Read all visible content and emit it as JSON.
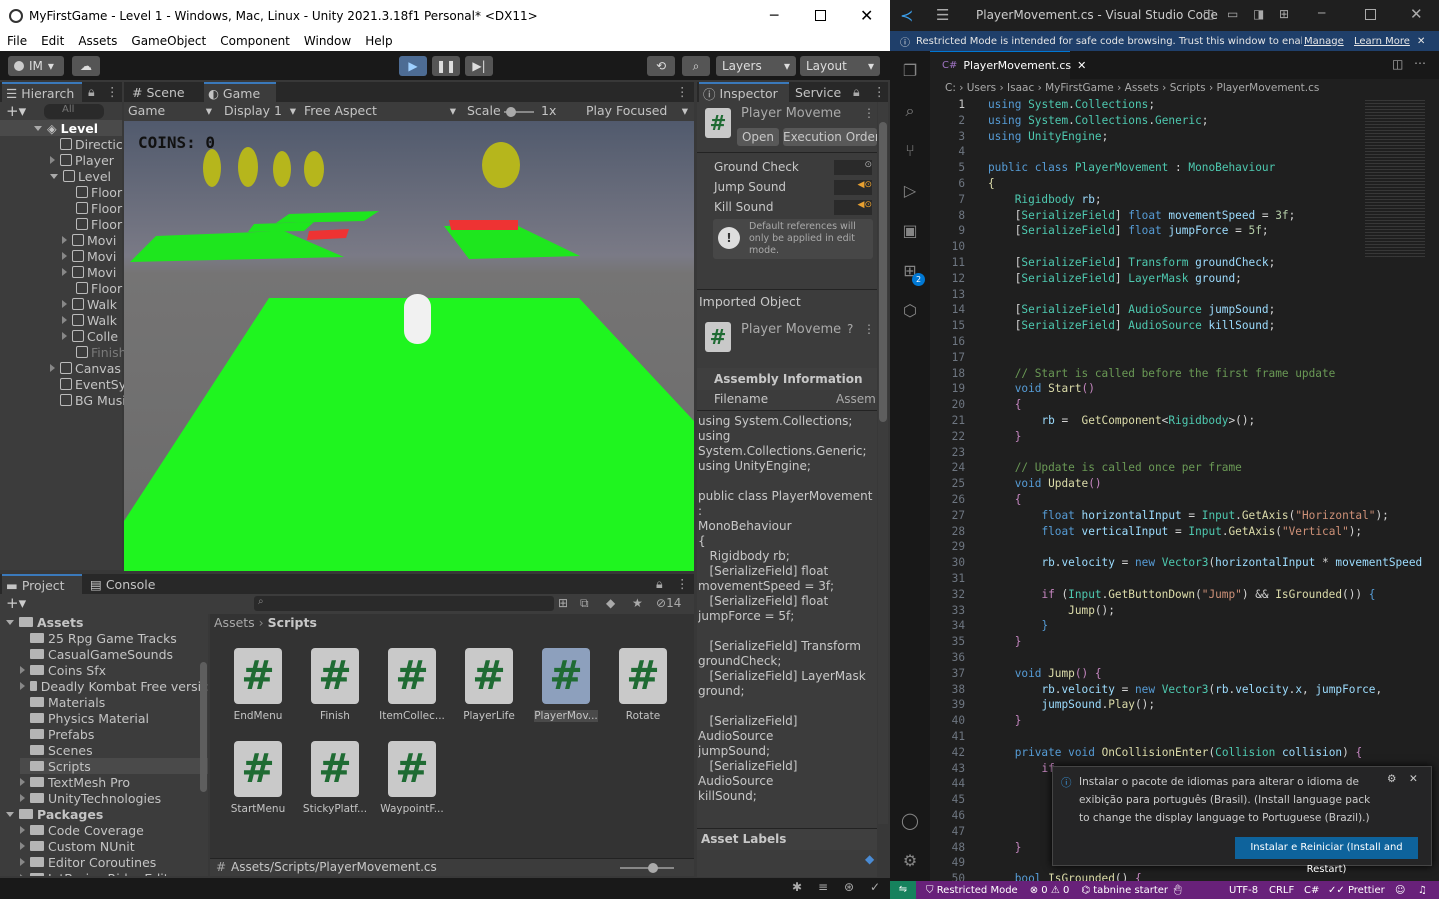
{
  "unity": {
    "title": "MyFirstGame - Level 1 - Windows, Mac, Linux - Unity 2021.3.18f1 Personal* <DX11>",
    "menu": [
      "File",
      "Edit",
      "Assets",
      "GameObject",
      "Component",
      "Window",
      "Help"
    ],
    "account": "IM",
    "layers": "Layers",
    "layout": "Layout",
    "hierarchy": {
      "tab": "Hierarch",
      "search_placeholder": "All",
      "root": "Level",
      "items": [
        "Directic",
        "Player",
        "Level",
        "Floor",
        "Floor",
        "Floor",
        "Movi",
        "Movi",
        "Movi",
        "Floor",
        "Walk",
        "Walk",
        "Colle",
        "Finish",
        "Canvas",
        "EventSy",
        "BG Musi"
      ]
    },
    "scene_tabs": {
      "scene": "Scene",
      "game": "Game"
    },
    "game_bar": {
      "mode": "Game",
      "display": "Display 1",
      "aspect": "Free Aspect",
      "scale_label": "Scale",
      "scale_value": "1x",
      "play_focused": "Play Focused"
    },
    "game_view": {
      "coins": "COINS: 0"
    },
    "inspector": {
      "tab": "Inspector",
      "tab2": "Service",
      "title": "Player Moveme",
      "open": "Open",
      "exec": "Execution Order",
      "fields": [
        {
          "label": "Ground Check"
        },
        {
          "label": "Jump Sound"
        },
        {
          "label": "Kill Sound"
        }
      ],
      "help": "Default references will only be applied in edit mode.",
      "imported": "Imported Object",
      "imported_title": "Player Moveme",
      "assembly_header": "Assembly Information",
      "filename_label": "Filename",
      "filename_value": "Assem",
      "code": "using System.Collections;\nusing\nSystem.Collections.Generic;\nusing UnityEngine;\n\npublic class PlayerMovement :\nMonoBehaviour\n{\n   Rigidbody rb;\n   [SerializeField] float\nmovementSpeed = 3f;\n   [SerializeField] float\njumpForce = 5f;\n\n   [SerializeField] Transform\ngroundCheck;\n   [SerializeField] LayerMask\nground;\n\n   [SerializeField] AudioSource\njumpSound;\n   [SerializeField] AudioSource\nkillSound;\n\n\n   // Start is called before the\nfirst frame update\n   void Start()",
      "asset_labels": "Asset Labels"
    },
    "project": {
      "tab": "Project",
      "console": "Console",
      "count": "14",
      "tree_root": "Assets",
      "tree": [
        "25 Rpg Game Tracks",
        "CasualGameSounds",
        "Coins Sfx",
        "Deadly Kombat Free versic",
        "Materials",
        "Physics Material",
        "Prefabs",
        "Scenes",
        "Scripts",
        "TextMesh Pro",
        "UnityTechnologies"
      ],
      "packages_root": "Packages",
      "packages": [
        "Code Coverage",
        "Custom NUnit",
        "Editor Coroutines",
        "JetBrains Rider Editor"
      ],
      "breadcrumb": [
        "Assets",
        "Scripts"
      ],
      "files": [
        "EndMenu",
        "Finish",
        "ItemCollec...",
        "PlayerLife",
        "PlayerMov...",
        "Rotate",
        "StartMenu",
        "StickyPlatf...",
        "WaypointF..."
      ],
      "path": "Assets/Scripts/PlayerMovement.cs"
    }
  },
  "vscode": {
    "title": "PlayerMovement.cs - Visual Studio Code",
    "banner": "Restricted Mode is intended for safe code browsing. Trust this window to enable all...",
    "manage": "Manage",
    "learn": "Learn More",
    "tab": "PlayerMovement.cs",
    "breadcrumb": [
      "C:",
      "Users",
      "Isaac",
      "MyFirstGame",
      "Assets",
      "Scripts",
      "PlayerMovement.cs"
    ],
    "badge": "2",
    "notification": "Instalar o pacote de idiomas para alterar o idioma de exibição para português (Brasil). (Install language pack to change the display language to Portuguese (Brazil).)",
    "notif_button": "Instalar e Reiniciar (Install and Restart)",
    "status": {
      "restricted": "Restricted Mode",
      "problems": "0",
      "warnings": "0",
      "tabnine": "tabnine starter",
      "enc": "UTF-8",
      "eol": "CRLF",
      "lang": "C#",
      "prettier": "Prettier"
    }
  }
}
